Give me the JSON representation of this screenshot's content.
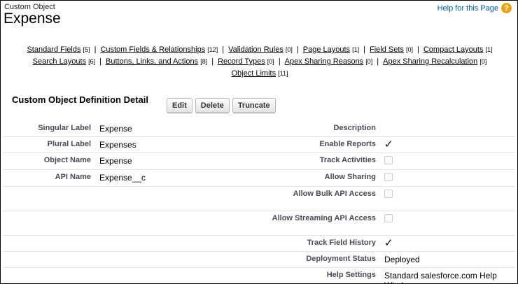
{
  "header": {
    "object_type": "Custom Object",
    "object_name": "Expense",
    "help_link": "Help for this Page",
    "help_icon": "?"
  },
  "related_links": [
    {
      "label": "Standard Fields",
      "count": "[5]"
    },
    {
      "label": "Custom Fields & Relationships",
      "count": "[12]"
    },
    {
      "label": "Validation Rules",
      "count": "[0]"
    },
    {
      "label": "Page Layouts",
      "count": "[1]"
    },
    {
      "label": "Field Sets",
      "count": "[0]"
    },
    {
      "label": "Compact Layouts",
      "count": "[1]"
    },
    {
      "label": "Search Layouts",
      "count": "[6]"
    },
    {
      "label": "Buttons, Links, and Actions",
      "count": "[8]"
    },
    {
      "label": "Record Types",
      "count": "[0]"
    },
    {
      "label": "Apex Sharing Reasons",
      "count": "[0]"
    },
    {
      "label": "Apex Sharing Recalculation",
      "count": "[0]"
    },
    {
      "label": "Object Limits",
      "count": "[11]"
    }
  ],
  "section": {
    "title": "Custom Object Definition Detail",
    "buttons": {
      "edit": "Edit",
      "delete": "Delete",
      "truncate": "Truncate"
    }
  },
  "left_fields": [
    {
      "label": "Singular Label",
      "value": "Expense"
    },
    {
      "label": "Plural Label",
      "value": "Expenses"
    },
    {
      "label": "Object Name",
      "value": "Expense"
    },
    {
      "label": "API Name",
      "value": "Expense__c"
    }
  ],
  "right_fields": [
    {
      "label": "Description",
      "type": "text",
      "value": ""
    },
    {
      "label": "Enable Reports",
      "type": "checkbox",
      "checked": true
    },
    {
      "label": "Track Activities",
      "type": "checkbox",
      "checked": false
    },
    {
      "label": "Allow Sharing",
      "type": "checkbox",
      "checked": false
    },
    {
      "label": "Allow Bulk API Access",
      "type": "checkbox",
      "checked": false
    },
    {
      "label": "Allow Streaming API Access",
      "type": "checkbox",
      "checked": false
    },
    {
      "label": "Track Field History",
      "type": "checkbox",
      "checked": true
    },
    {
      "label": "Deployment Status",
      "type": "text",
      "value": "Deployed"
    },
    {
      "label": "Help Settings",
      "type": "text",
      "value": "Standard salesforce.com Help Window"
    }
  ],
  "checkmark": "✓",
  "colors": {
    "link_blue": "#015ba7",
    "help_icon": "#e8a317",
    "label_gray": "#4a4a56"
  }
}
